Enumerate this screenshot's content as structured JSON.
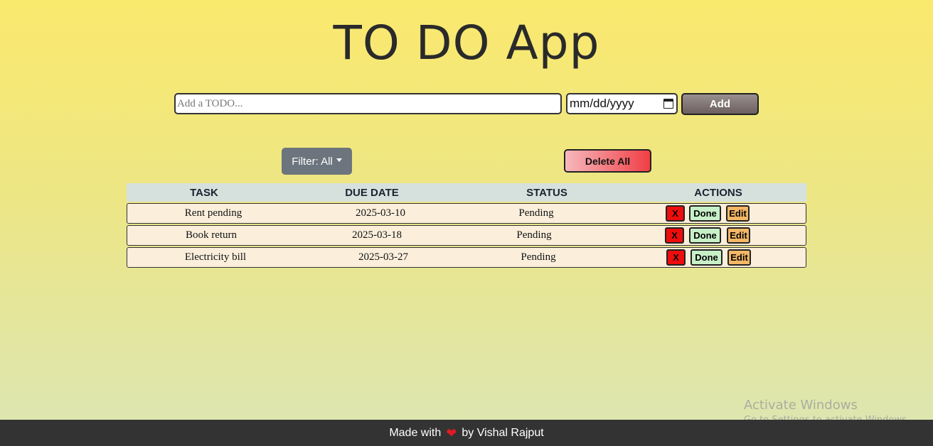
{
  "app": {
    "title": "TO DO App"
  },
  "add_form": {
    "input_placeholder": "Add a TODO...",
    "input_value": "",
    "date_placeholder": "mm/dd/yyyy",
    "add_label": "Add"
  },
  "toolbar": {
    "filter_label": "Filter: All",
    "delete_all_label": "Delete All"
  },
  "table": {
    "headers": [
      "TASK",
      "DUE DATE",
      "STATUS",
      "ACTIONS"
    ],
    "rows": [
      {
        "task": "Rent pending",
        "due": "2025-03-10",
        "status": "Pending"
      },
      {
        "task": "Book return",
        "due": "2025-03-18",
        "status": "Pending"
      },
      {
        "task": "Electricity bill",
        "due": "2025-03-27",
        "status": "Pending"
      }
    ],
    "actions": {
      "delete": "X",
      "done": "Done",
      "edit": "Edit"
    }
  },
  "watermark": {
    "line1": "Activate Windows",
    "line2": "Go to Settings to activate Windows."
  },
  "footer": {
    "prefix": "Made with",
    "suffix": "by Vishal Rajput",
    "heart_icon": "heart-icon"
  },
  "colors": {
    "delete": "#ee0d0d",
    "done": "#c8f0c8",
    "edit": "#f3b766",
    "footer_bg": "#333333",
    "heart": "#e01b24"
  }
}
